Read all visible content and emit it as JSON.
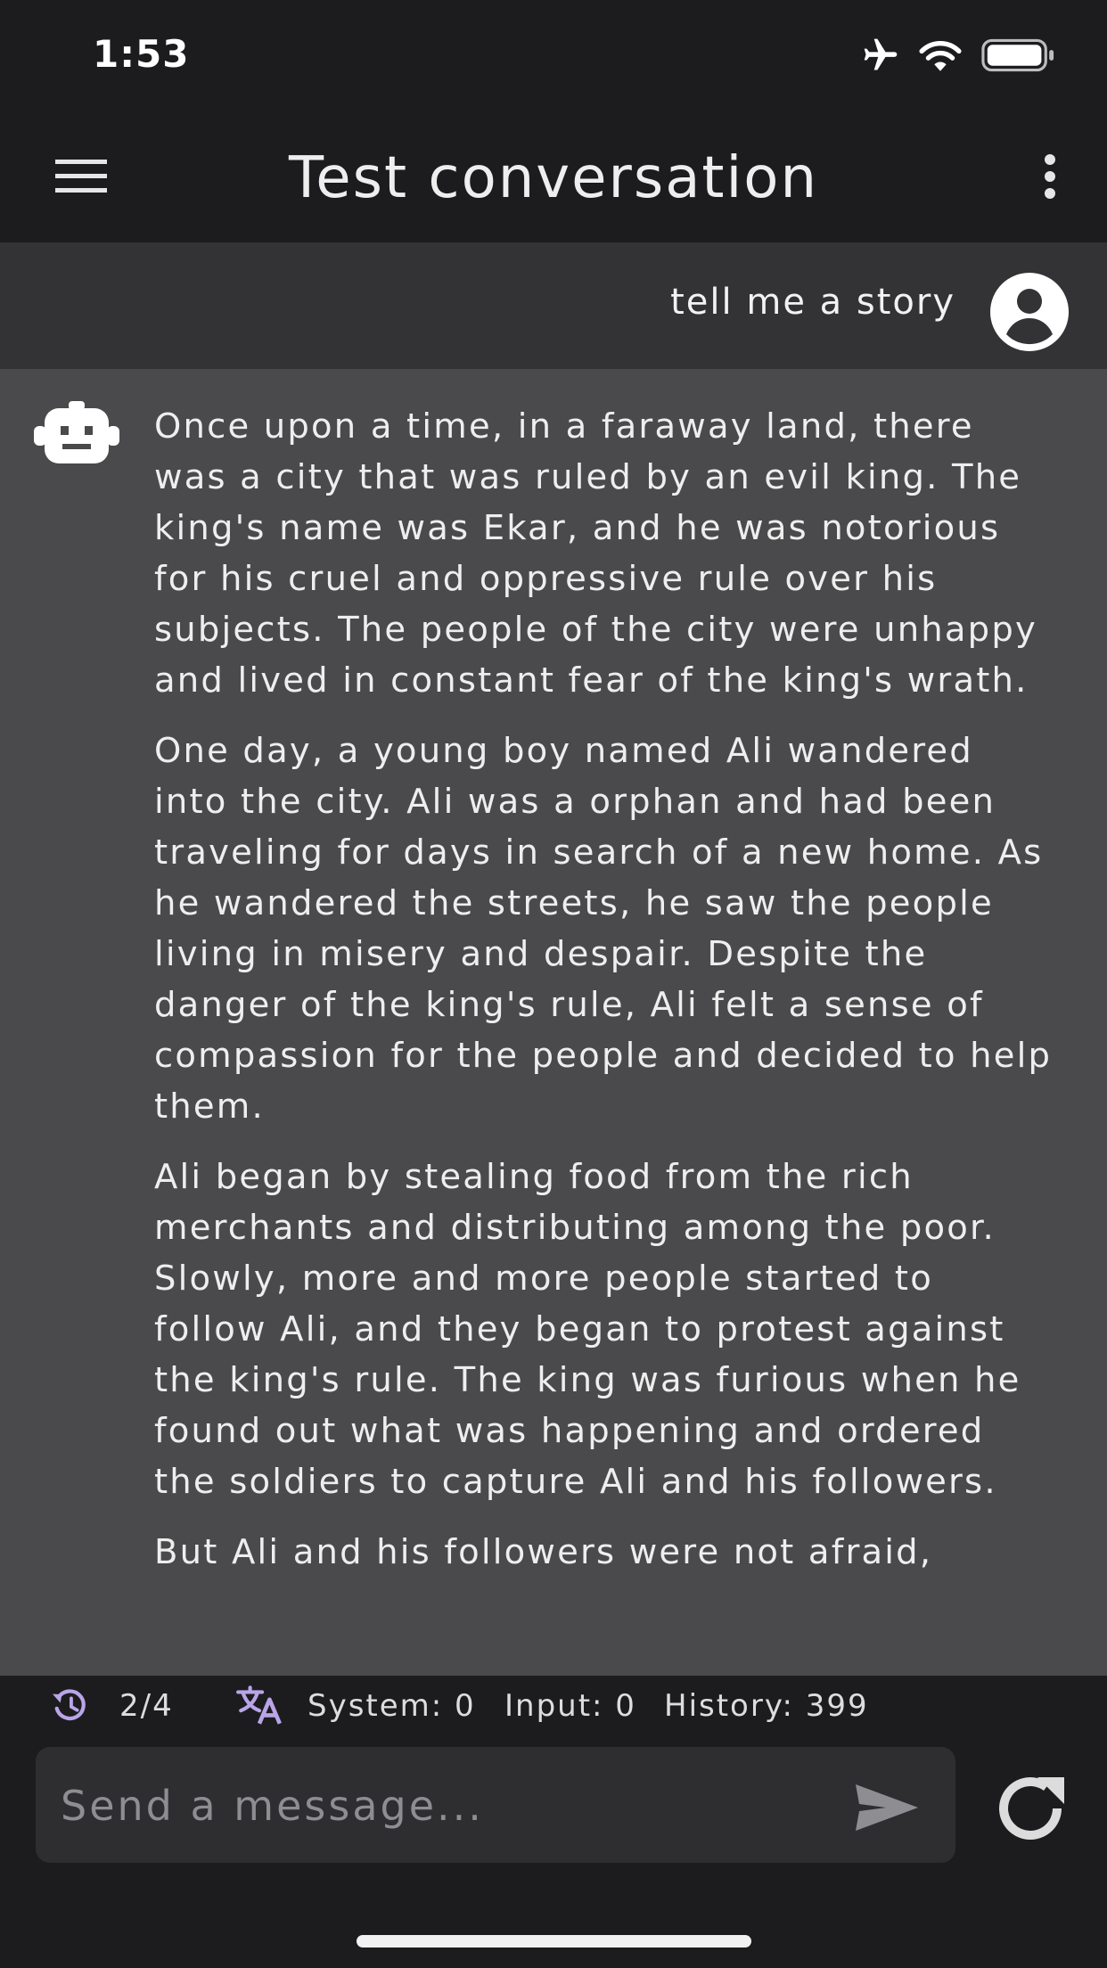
{
  "status_bar": {
    "time": "1:53",
    "icons": [
      "airplane-icon",
      "wifi-icon",
      "battery-icon"
    ]
  },
  "app_bar": {
    "title": "Test conversation",
    "icons": [
      "menu-icon",
      "more-vert-icon"
    ]
  },
  "user_message": {
    "text": "tell me a story",
    "avatar": "account-circle-icon"
  },
  "bot_message": {
    "avatar": "robot-icon",
    "paragraphs": [
      "Once upon a time, in a faraway land, there was a city that was ruled by an evil king. The king's name was Ekar, and he was notorious for his cruel and oppressive rule over his subjects. The people of the city were unhappy and lived in constant fear of the king's wrath.",
      "One day, a young boy named Ali wandered into the city. Ali was a orphan and had been traveling for days in search of a new home. As he wandered the streets, he saw the people living in misery and despair. Despite the danger of the king's rule, Ali felt a sense of compassion for the people and decided to help them.",
      "Ali began by stealing food from the rich merchants and distributing among the poor. Slowly, more and more people started to follow Ali, and they began to protest against the king's rule. The king was furious when he found out what was happening and ordered the soldiers to capture Ali and his followers.",
      "But Ali and his followers were not afraid,"
    ]
  },
  "stats": {
    "history_count": "2/4",
    "system": "System: 0",
    "input": "Input: 0",
    "history": "History: 399",
    "icon_color": "#b9a5e8"
  },
  "composer": {
    "placeholder": "Send a message...",
    "send_icon": "send-icon",
    "regenerate_icon": "refresh-icon"
  }
}
